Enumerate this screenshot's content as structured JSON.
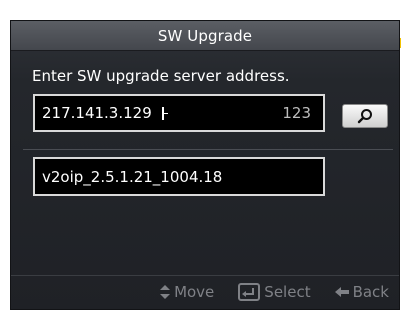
{
  "dialog": {
    "title": "SW Upgrade",
    "prompt": "Enter SW upgrade server address.",
    "server_field": {
      "value": "217.141.3.129",
      "char_count": "123"
    },
    "firmware_field": {
      "value": "v2oip_2.5.1.21_1004.18"
    }
  },
  "footer": {
    "move_label": "Move",
    "select_label": "Select",
    "back_label": "Back"
  },
  "icons": {
    "search": "search-icon",
    "move": "up-down-arrows-icon",
    "select": "enter-icon",
    "back": "back-arrow-icon"
  },
  "colors": {
    "background": "#24272c",
    "title_bar": "#4f5258",
    "field_border": "#d9d9d9",
    "hint_text": "#7f8186"
  }
}
